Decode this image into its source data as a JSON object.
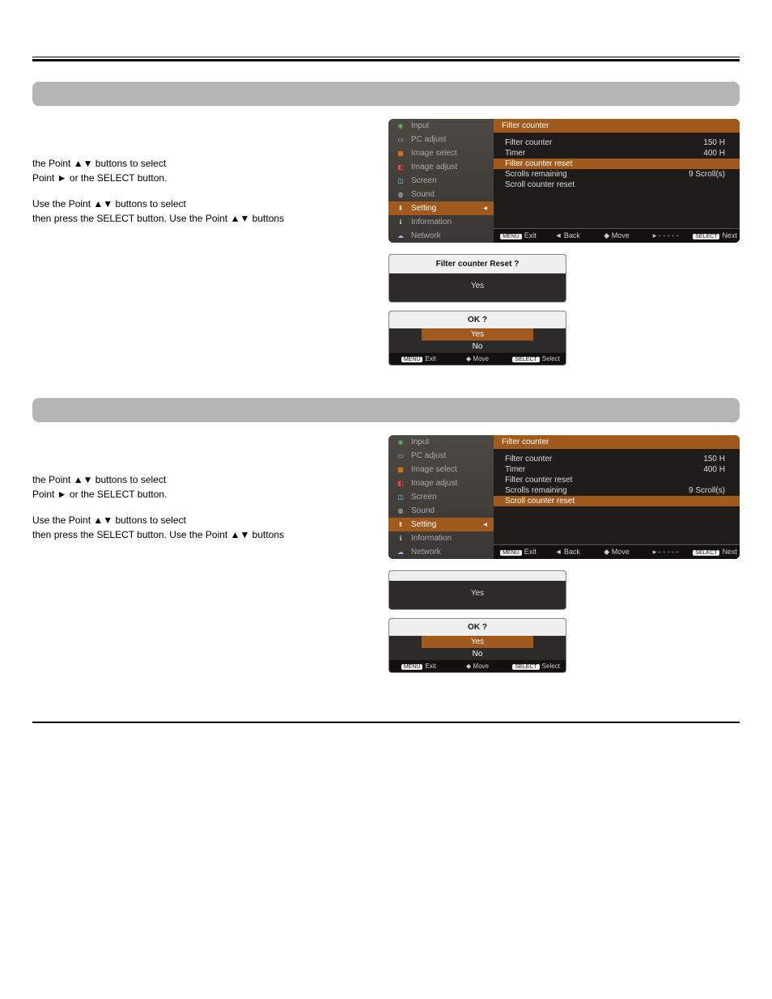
{
  "section1": {
    "bar": ""
  },
  "section2": {
    "bar": ""
  },
  "text1_p1": "the Point ▲▼ buttons to select",
  "text1_p1b": "Point ► or the SELECT button.",
  "text1_p2": "Use the Point ▲▼ buttons to select",
  "text1_p2b": "then press the SELECT button. Use the Point ▲▼ buttons",
  "text2_p1": "the Point ▲▼ buttons to select",
  "text2_p1b": "Point ► or the SELECT button.",
  "text2_p2": "Use the Point ▲▼ buttons to select",
  "text2_p2b": "then press the SELECT button. Use the Point ▲▼ buttons",
  "menu": {
    "items": [
      {
        "label": "Input"
      },
      {
        "label": "PC adjust"
      },
      {
        "label": "Image select"
      },
      {
        "label": "Image adjust"
      },
      {
        "label": "Screen"
      },
      {
        "label": "Sound"
      },
      {
        "label": "Setting"
      },
      {
        "label": "Information"
      },
      {
        "label": "Network"
      }
    ]
  },
  "panel_header": "Filter counter",
  "rows": {
    "filter_counter": {
      "label": "Filter counter",
      "val": "150 H"
    },
    "timer": {
      "label": "Timer",
      "val": "400 H"
    },
    "filter_reset": {
      "label": "Filter counter reset",
      "val": ""
    },
    "scrolls_remaining": {
      "label": "Scrolls remaining",
      "val": "9 Scroll(s)"
    },
    "scroll_reset": {
      "label": "Scroll counter reset",
      "val": ""
    }
  },
  "footer": {
    "exit_btn": "MENU",
    "exit": "Exit",
    "back": "◄ Back",
    "move": "◆ Move",
    "dash": "▸ - - - - -",
    "next_btn": "SELECT",
    "next": "Next"
  },
  "dialog1": {
    "title_a": "Filter counter Reset ?",
    "title_b": "",
    "yes": "Yes",
    "ok": "OK ?",
    "opt_yes": "Yes",
    "opt_no": "No",
    "f_exit_btn": "MENU",
    "f_exit": "Exit",
    "f_move": "◆ Move",
    "f_select_btn": "SELECT",
    "f_select": "Select"
  },
  "dialog2": {
    "title_a": "",
    "yes": "Yes",
    "ok": "OK ?",
    "opt_yes": "Yes",
    "opt_no": "No",
    "f_exit_btn": "MENU",
    "f_exit": "Exit",
    "f_move": "◆ Move",
    "f_select_btn": "SELECT",
    "f_select": "Select"
  }
}
